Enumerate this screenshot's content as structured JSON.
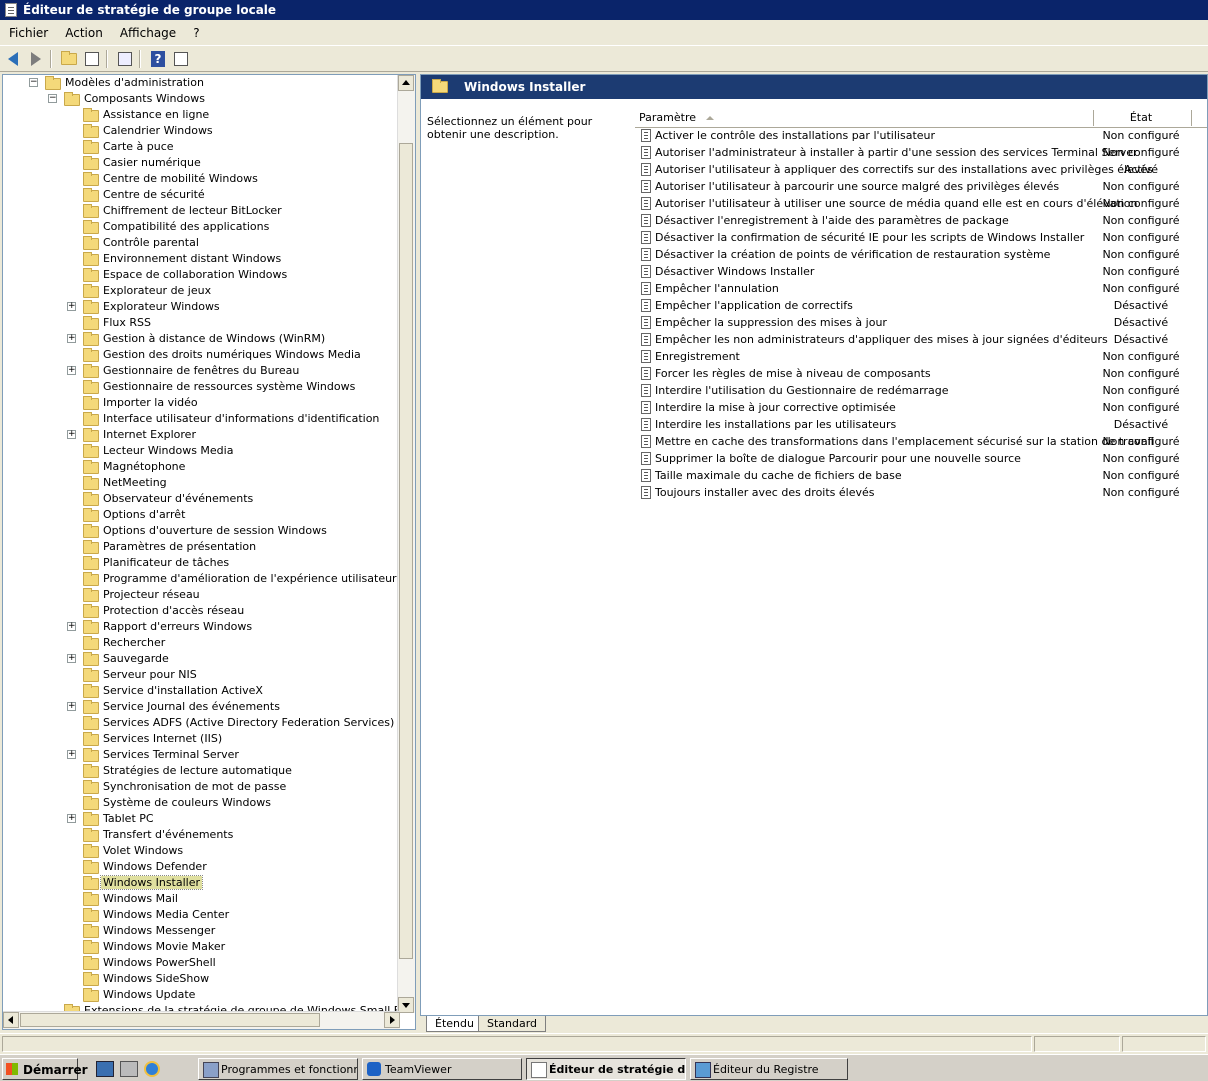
{
  "window": {
    "title": "Éditeur de stratégie de groupe locale"
  },
  "menu": [
    "Fichier",
    "Action",
    "Affichage",
    "?"
  ],
  "toolbar": {
    "icons": [
      "back-arrow-icon",
      "forward-arrow-icon",
      "up-folder-icon",
      "show-hide-tree-icon",
      "export-list-icon",
      "help-icon",
      "properties-icon"
    ]
  },
  "tree": {
    "root": "Modèles d'administration",
    "parent": "Composants Windows",
    "items": [
      {
        "label": "Assistance en ligne",
        "expandable": false
      },
      {
        "label": "Calendrier Windows",
        "expandable": false
      },
      {
        "label": "Carte à puce",
        "expandable": false
      },
      {
        "label": "Casier numérique",
        "expandable": false
      },
      {
        "label": "Centre de mobilité Windows",
        "expandable": false
      },
      {
        "label": "Centre de sécurité",
        "expandable": false
      },
      {
        "label": "Chiffrement de lecteur BitLocker",
        "expandable": false
      },
      {
        "label": "Compatibilité des applications",
        "expandable": false
      },
      {
        "label": "Contrôle parental",
        "expandable": false
      },
      {
        "label": "Environnement distant Windows",
        "expandable": false
      },
      {
        "label": "Espace de collaboration Windows",
        "expandable": false
      },
      {
        "label": "Explorateur de jeux",
        "expandable": false
      },
      {
        "label": "Explorateur Windows",
        "expandable": true
      },
      {
        "label": "Flux RSS",
        "expandable": false
      },
      {
        "label": "Gestion à distance de Windows (WinRM)",
        "expandable": true
      },
      {
        "label": "Gestion des droits numériques Windows Media",
        "expandable": false
      },
      {
        "label": "Gestionnaire de fenêtres du Bureau",
        "expandable": true
      },
      {
        "label": "Gestionnaire de ressources système Windows",
        "expandable": false
      },
      {
        "label": "Importer la vidéo",
        "expandable": false
      },
      {
        "label": "Interface utilisateur d'informations d'identification",
        "expandable": false
      },
      {
        "label": "Internet Explorer",
        "expandable": true
      },
      {
        "label": "Lecteur Windows Media",
        "expandable": false
      },
      {
        "label": "Magnétophone",
        "expandable": false
      },
      {
        "label": "NetMeeting",
        "expandable": false
      },
      {
        "label": "Observateur d'événements",
        "expandable": false
      },
      {
        "label": "Options d'arrêt",
        "expandable": false
      },
      {
        "label": "Options d'ouverture de session Windows",
        "expandable": false
      },
      {
        "label": "Paramètres de présentation",
        "expandable": false
      },
      {
        "label": "Planificateur de tâches",
        "expandable": false
      },
      {
        "label": "Programme d'amélioration de l'expérience utilisateur Windows",
        "expandable": false
      },
      {
        "label": "Projecteur réseau",
        "expandable": false
      },
      {
        "label": "Protection d'accès réseau",
        "expandable": false
      },
      {
        "label": "Rapport d'erreurs Windows",
        "expandable": true
      },
      {
        "label": "Rechercher",
        "expandable": false
      },
      {
        "label": "Sauvegarde",
        "expandable": true
      },
      {
        "label": "Serveur pour NIS",
        "expandable": false
      },
      {
        "label": "Service d'installation ActiveX",
        "expandable": false
      },
      {
        "label": "Service Journal des événements",
        "expandable": true
      },
      {
        "label": "Services ADFS (Active Directory Federation Services)",
        "expandable": false
      },
      {
        "label": "Services Internet (IIS)",
        "expandable": false
      },
      {
        "label": "Services Terminal Server",
        "expandable": true
      },
      {
        "label": "Stratégies de lecture automatique",
        "expandable": false
      },
      {
        "label": "Synchronisation de mot de passe",
        "expandable": false
      },
      {
        "label": "Système de couleurs Windows",
        "expandable": false
      },
      {
        "label": "Tablet PC",
        "expandable": true
      },
      {
        "label": "Transfert d'événements",
        "expandable": false
      },
      {
        "label": "Volet Windows",
        "expandable": false
      },
      {
        "label": "Windows Defender",
        "expandable": false
      },
      {
        "label": "Windows Installer",
        "expandable": false,
        "selected": true
      },
      {
        "label": "Windows Mail",
        "expandable": false
      },
      {
        "label": "Windows Media Center",
        "expandable": false
      },
      {
        "label": "Windows Messenger",
        "expandable": false
      },
      {
        "label": "Windows Movie Maker",
        "expandable": false
      },
      {
        "label": "Windows PowerShell",
        "expandable": false
      },
      {
        "label": "Windows SideShow",
        "expandable": false
      },
      {
        "label": "Windows Update",
        "expandable": false
      }
    ],
    "last": "Extensions de la stratégie de groupe de Windows Small Business S"
  },
  "panel": {
    "title": "Windows Installer",
    "description": "Sélectionnez un élément pour obtenir une description.",
    "col_param": "Paramètre",
    "col_state": "État",
    "rows": [
      {
        "name": "Activer le contrôle des installations par l'utilisateur",
        "state": "Non configuré"
      },
      {
        "name": "Autoriser l'administrateur à installer à partir d'une session des services Terminal Server",
        "state": "Non configuré"
      },
      {
        "name": "Autoriser l'utilisateur à appliquer des correctifs sur des installations avec privilèges élevés",
        "state": "Activé"
      },
      {
        "name": "Autoriser l'utilisateur à parcourir une source malgré des privilèges élevés",
        "state": "Non configuré"
      },
      {
        "name": "Autoriser l'utilisateur à utiliser une source de média quand elle est en cours d'élévation",
        "state": "Non configuré"
      },
      {
        "name": "Désactiver l'enregistrement à l'aide des paramètres de package",
        "state": "Non configuré"
      },
      {
        "name": "Désactiver la confirmation de sécurité IE pour les scripts de Windows Installer",
        "state": "Non configuré"
      },
      {
        "name": "Désactiver la création de points de vérification de restauration système",
        "state": "Non configuré"
      },
      {
        "name": "Désactiver Windows Installer",
        "state": "Non configuré"
      },
      {
        "name": "Empêcher l'annulation",
        "state": "Non configuré"
      },
      {
        "name": "Empêcher l'application de correctifs",
        "state": "Désactivé"
      },
      {
        "name": "Empêcher la suppression des mises à jour",
        "state": "Désactivé"
      },
      {
        "name": "Empêcher les non administrateurs d'appliquer des mises à jour signées d'éditeurs",
        "state": "Désactivé"
      },
      {
        "name": "Enregistrement",
        "state": "Non configuré"
      },
      {
        "name": "Forcer les règles de mise à niveau de composants",
        "state": "Non configuré"
      },
      {
        "name": "Interdire l'utilisation du Gestionnaire de redémarrage",
        "state": "Non configuré"
      },
      {
        "name": "Interdire la mise à jour corrective optimisée",
        "state": "Non configuré"
      },
      {
        "name": "Interdire les installations par les utilisateurs",
        "state": "Désactivé"
      },
      {
        "name": "Mettre en cache des transformations dans l'emplacement sécurisé sur la station de travail",
        "state": "Non configuré"
      },
      {
        "name": "Supprimer la boîte de dialogue Parcourir pour une nouvelle source",
        "state": "Non configuré"
      },
      {
        "name": "Taille maximale du cache de fichiers de base",
        "state": "Non configuré"
      },
      {
        "name": "Toujours installer avec des droits élevés",
        "state": "Non configuré"
      }
    ]
  },
  "tabs": [
    "Étendu",
    "Standard"
  ],
  "taskbar": {
    "start": "Démarrer",
    "buttons": [
      {
        "label": "Programmes et fonctionn...",
        "icon": "control-panel-icon"
      },
      {
        "label": "TeamViewer",
        "icon": "teamviewer-icon"
      },
      {
        "label": "Éditeur de stratégie d...",
        "icon": "policy-editor-icon",
        "active": true
      },
      {
        "label": "Éditeur du Registre",
        "icon": "registry-editor-icon"
      }
    ]
  }
}
